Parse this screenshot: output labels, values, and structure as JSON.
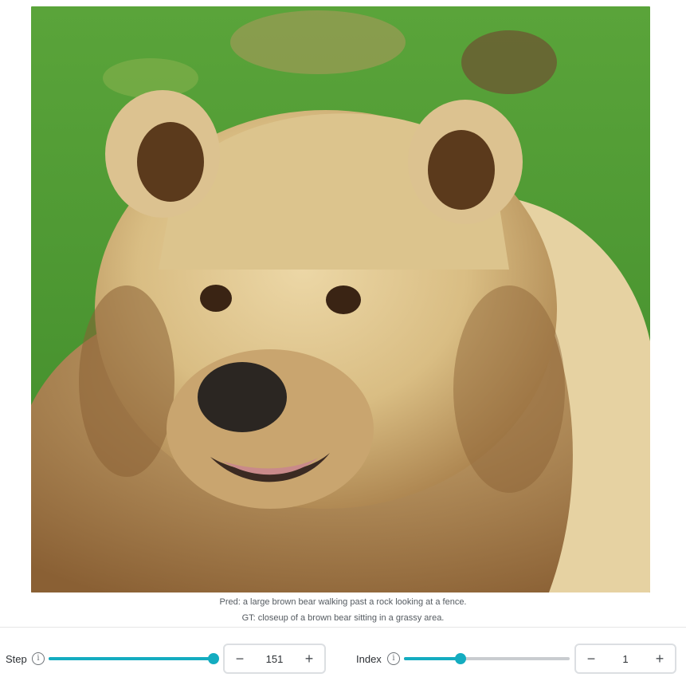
{
  "image": {
    "alt": "close-up photo of a light brown bear on green grass",
    "grass_color": "#4f9a33",
    "fur_color": "#d9bd83"
  },
  "captions": {
    "pred": "Pred: a large brown bear walking past a rock looking at a fence.",
    "gt": "GT: closeup of a brown bear sitting in a grassy area."
  },
  "controls": {
    "accent_color": "#14acc0",
    "step": {
      "label": "Step",
      "info_icon": "info-icon",
      "value": "151",
      "slider_fraction": 1.0,
      "decrement": "−",
      "increment": "+"
    },
    "index": {
      "label": "Index",
      "info_icon": "info-icon",
      "value": "1",
      "slider_fraction": 0.34,
      "decrement": "−",
      "increment": "+"
    }
  }
}
